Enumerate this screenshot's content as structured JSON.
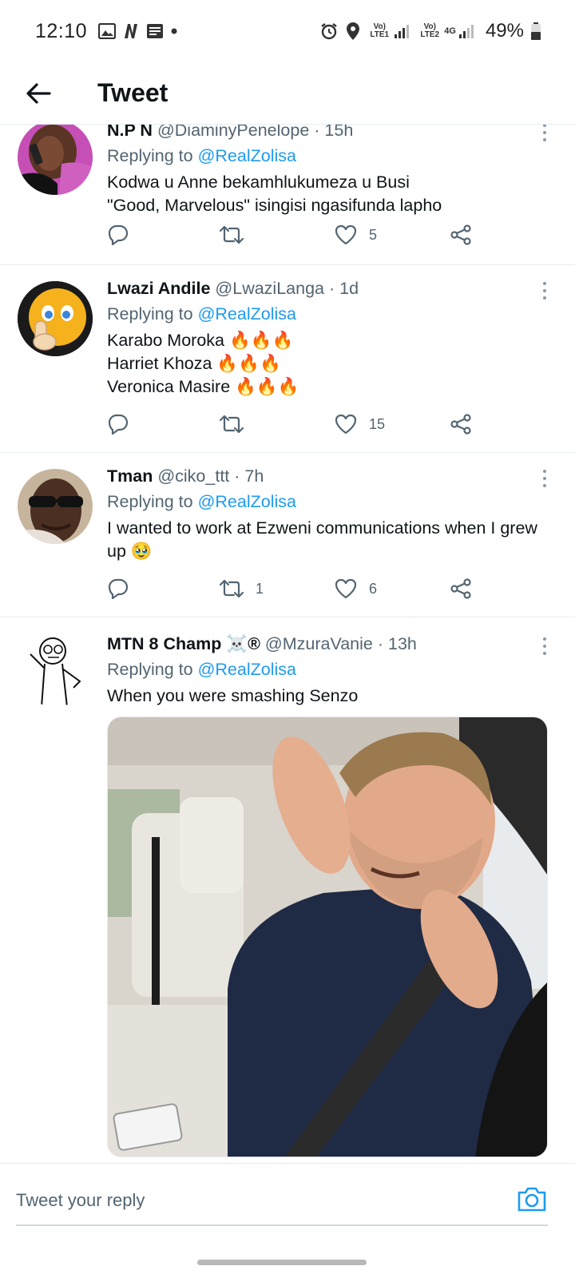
{
  "status_bar": {
    "time": "12:10",
    "left_icons": [
      "image-icon",
      "netflix-n-icon",
      "news-icon",
      "dot-icon"
    ],
    "sim1_label": "Vo) LTE1",
    "sim2_label": "Vo) LTE2",
    "sim2_net": "4G",
    "battery": "49%"
  },
  "header": {
    "title": "Tweet"
  },
  "tweets": [
    {
      "display_name": "N.P N",
      "handle": "@DiaminyPenelope",
      "time": "· 15h",
      "replying_prefix": "Replying to",
      "replying_handle": "@RealZolisa",
      "lines": [
        "Kodwa u Anne bekamhlukumeza u Busi",
        "\"Good, Marvelous\" isingisi ngasifunda lapho"
      ],
      "retweets": "",
      "likes": "5"
    },
    {
      "display_name": "Lwazi Andile",
      "handle": "@LwaziLanga",
      "time": "· 1d",
      "replying_prefix": "Replying to",
      "replying_handle": "@RealZolisa",
      "lines": [
        "Karabo Moroka 🔥🔥🔥",
        "Harriet Khoza 🔥🔥🔥",
        "Veronica Masire 🔥🔥🔥"
      ],
      "retweets": "",
      "likes": "15"
    },
    {
      "display_name": "Tman",
      "handle": "@ciko_ttt",
      "time": "· 7h",
      "replying_prefix": "Replying to",
      "replying_handle": "@RealZolisa",
      "lines": [
        "I wanted to work at Ezweni communications when I grew",
        "up 🥹"
      ],
      "retweets": "1",
      "likes": "6"
    },
    {
      "display_name": "MTN 8 Champ ☠️®",
      "handle": "@MzuraVanie",
      "time": "· 13h",
      "replying_prefix": "Replying to",
      "replying_handle": "@RealZolisa",
      "lines": [
        "When you were smashing Senzo"
      ],
      "media": "video-still-man-in-car"
    }
  ],
  "composer": {
    "placeholder": "Tweet your reply"
  },
  "colors": {
    "link": "#1d9bf0",
    "secondary_text": "#536471",
    "primary_text": "#0f1419",
    "divider": "#e6ecf0"
  }
}
